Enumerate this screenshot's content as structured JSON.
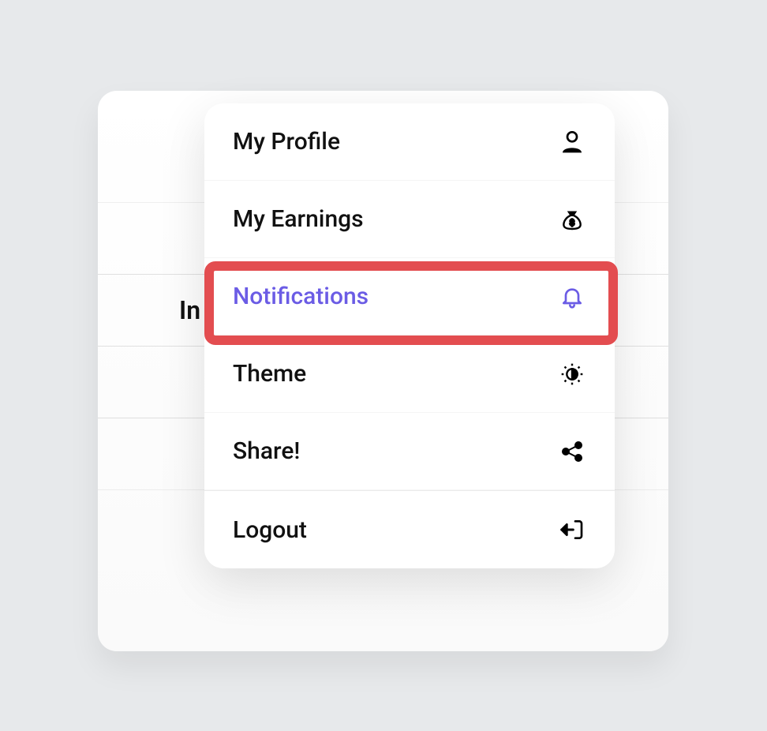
{
  "background": {
    "partial_label": "In"
  },
  "menu": {
    "items": [
      {
        "label": "My Profile",
        "icon": "user"
      },
      {
        "label": "My Earnings",
        "icon": "money-bag"
      },
      {
        "label": "Notifications",
        "icon": "bell",
        "active": true
      },
      {
        "label": "Theme",
        "icon": "contrast"
      },
      {
        "label": "Share!",
        "icon": "share"
      },
      {
        "label": "Logout",
        "icon": "logout"
      }
    ]
  },
  "colors": {
    "accent": "#6b5ce5",
    "highlight_border": "#e34d50"
  }
}
